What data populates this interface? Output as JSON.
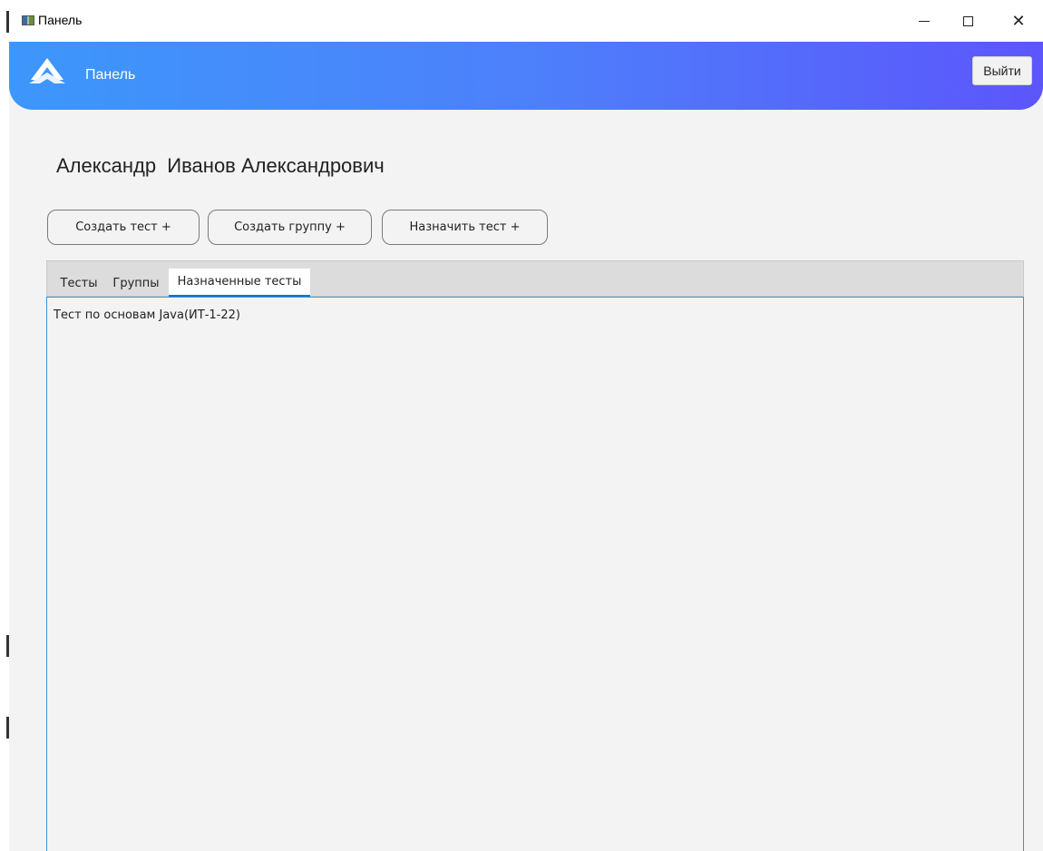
{
  "window": {
    "title": "Панель",
    "controls": {
      "minimize": "—",
      "maximize": "",
      "close": "✕"
    }
  },
  "header": {
    "title": "Панель",
    "logout_label": "Выйти",
    "gradient_colors": [
      "#3d97fb",
      "#5c56fb"
    ]
  },
  "user": {
    "full_name": "Александр  Иванов Александрович"
  },
  "actions": {
    "create_test": "Создать тест +",
    "create_group": "Создать группу +",
    "assign_test": "Назначить тест +"
  },
  "tabs": [
    {
      "label": "Тесты",
      "selected": false
    },
    {
      "label": "Группы",
      "selected": false
    },
    {
      "label": "Назначенные тесты",
      "selected": true
    }
  ],
  "assigned_tests": [
    "Тест по основам Java(ИТ-1-22)"
  ],
  "colors": {
    "selected_tab_underline": "#0a74d8",
    "content_border": "#3b93d6"
  }
}
